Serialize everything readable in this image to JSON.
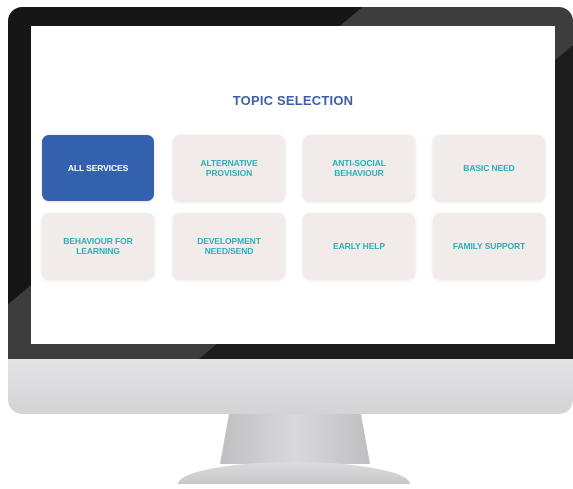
{
  "screen": {
    "title": "TOPIC SELECTION",
    "topics": [
      {
        "label": "ALL SERVICES",
        "active": true
      },
      {
        "label": "ALTERNATIVE PROVISION",
        "active": false
      },
      {
        "label": "ANTI-SOCIAL BEHAVIOUR",
        "active": false
      },
      {
        "label": "BASIC NEED",
        "active": false
      },
      {
        "label": "BEHAVIOUR FOR LEARNING",
        "active": false
      },
      {
        "label": "DEVELOPMENT NEED/SEND",
        "active": false
      },
      {
        "label": "EARLY HELP",
        "active": false
      },
      {
        "label": "FAMILY SUPPORT",
        "active": false
      }
    ]
  },
  "colors": {
    "title": "#3b5fa8",
    "tile_text": "#2bb0b8",
    "tile_bg": "#f1ece9",
    "active_bg": "#3461ad"
  }
}
